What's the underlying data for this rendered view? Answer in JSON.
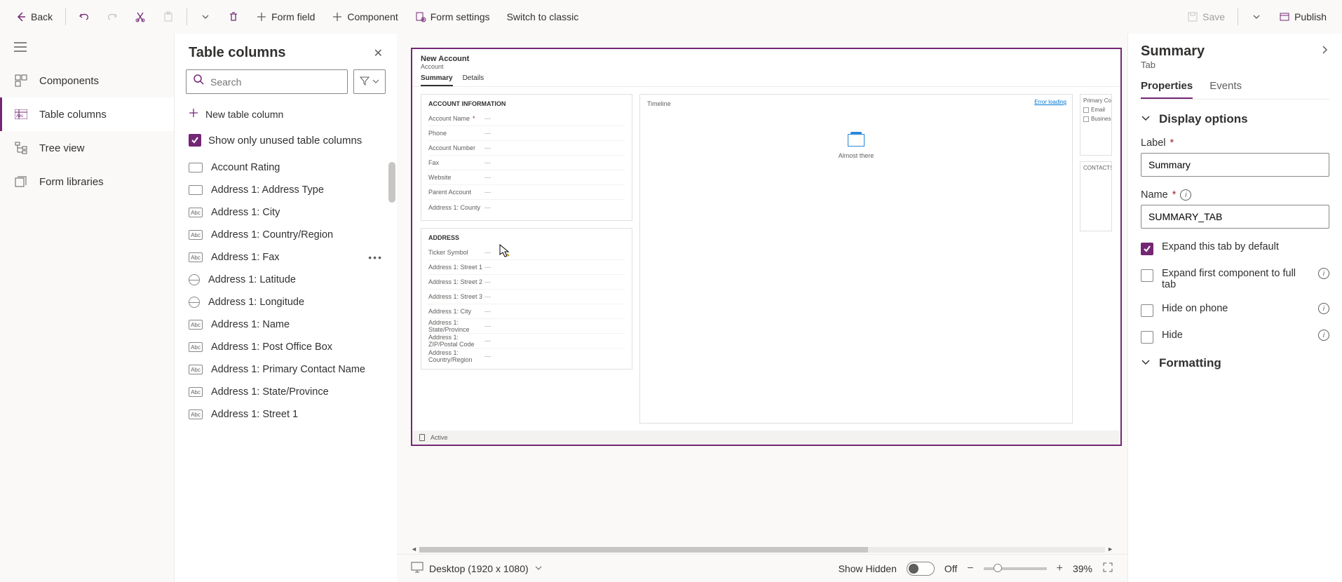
{
  "toolbar": {
    "back": "Back",
    "form_field": "Form field",
    "component": "Component",
    "form_settings": "Form settings",
    "switch_classic": "Switch to classic",
    "save": "Save",
    "publish": "Publish"
  },
  "left_rail": {
    "items": [
      {
        "label": "Components",
        "icon": "components"
      },
      {
        "label": "Table columns",
        "icon": "table-columns"
      },
      {
        "label": "Tree view",
        "icon": "tree"
      },
      {
        "label": "Form libraries",
        "icon": "libraries"
      }
    ],
    "active_index": 1
  },
  "columns_panel": {
    "title": "Table columns",
    "search_placeholder": "Search",
    "new_column": "New table column",
    "show_unused": "Show only unused table columns",
    "show_unused_checked": true,
    "items": [
      {
        "label": "Account Rating",
        "type": "option"
      },
      {
        "label": "Address 1: Address Type",
        "type": "option"
      },
      {
        "label": "Address 1: City",
        "type": "text"
      },
      {
        "label": "Address 1: Country/Region",
        "type": "text"
      },
      {
        "label": "Address 1: Fax",
        "type": "text",
        "hover": true
      },
      {
        "label": "Address 1: Latitude",
        "type": "globe"
      },
      {
        "label": "Address 1: Longitude",
        "type": "globe"
      },
      {
        "label": "Address 1: Name",
        "type": "text"
      },
      {
        "label": "Address 1: Post Office Box",
        "type": "text"
      },
      {
        "label": "Address 1: Primary Contact Name",
        "type": "text"
      },
      {
        "label": "Address 1: State/Province",
        "type": "text"
      },
      {
        "label": "Address 1: Street 1",
        "type": "text"
      }
    ]
  },
  "form_preview": {
    "title": "New Account",
    "subtitle": "Account",
    "tabs": [
      "Summary",
      "Details"
    ],
    "active_tab": 0,
    "section1": {
      "title": "ACCOUNT INFORMATION",
      "fields": [
        {
          "label": "Account Name",
          "required": true,
          "value": "---"
        },
        {
          "label": "Phone",
          "value": "---"
        },
        {
          "label": "Account Number",
          "value": "---"
        },
        {
          "label": "Fax",
          "value": "---"
        },
        {
          "label": "Website",
          "value": "---"
        },
        {
          "label": "Parent Account",
          "value": "---"
        },
        {
          "label": "Address 1: County",
          "value": "---"
        }
      ]
    },
    "section2": {
      "title": "ADDRESS",
      "fields": [
        {
          "label": "Ticker Symbol",
          "value": "---"
        },
        {
          "label": "Address 1: Street 1",
          "value": "---"
        },
        {
          "label": "Address 1: Street 2",
          "value": "---"
        },
        {
          "label": "Address 1: Street 3",
          "value": "---"
        },
        {
          "label": "Address 1: City",
          "value": "---"
        },
        {
          "label": "Address 1: State/Province",
          "value": "---"
        },
        {
          "label": "Address 1: ZIP/Postal Code",
          "value": "---"
        },
        {
          "label": "Address 1: Country/Region",
          "value": "---"
        }
      ]
    },
    "timeline": {
      "title": "Timeline",
      "caption": "Almost there",
      "error": "Error loading"
    },
    "right_cards": {
      "primary_contact": "Primary Co",
      "email": "Email",
      "business": "Business",
      "contacts": "CONTACTS"
    },
    "footer_status": "Active"
  },
  "statusbar": {
    "viewport": "Desktop (1920 x 1080)",
    "show_hidden": "Show Hidden",
    "toggle_state": "Off",
    "zoom": "39%"
  },
  "prop_panel": {
    "title": "Summary",
    "subtitle": "Tab",
    "tabs": [
      "Properties",
      "Events"
    ],
    "active_tab": 0,
    "section_display": "Display options",
    "label_field": {
      "label": "Label",
      "value": "Summary"
    },
    "name_field": {
      "label": "Name",
      "value": "SUMMARY_TAB"
    },
    "expand_default": {
      "label": "Expand this tab by default",
      "checked": true
    },
    "expand_first": {
      "label": "Expand first component to full tab",
      "checked": false
    },
    "hide_phone": {
      "label": "Hide on phone",
      "checked": false
    },
    "hide": {
      "label": "Hide",
      "checked": false
    },
    "section_formatting": "Formatting"
  }
}
